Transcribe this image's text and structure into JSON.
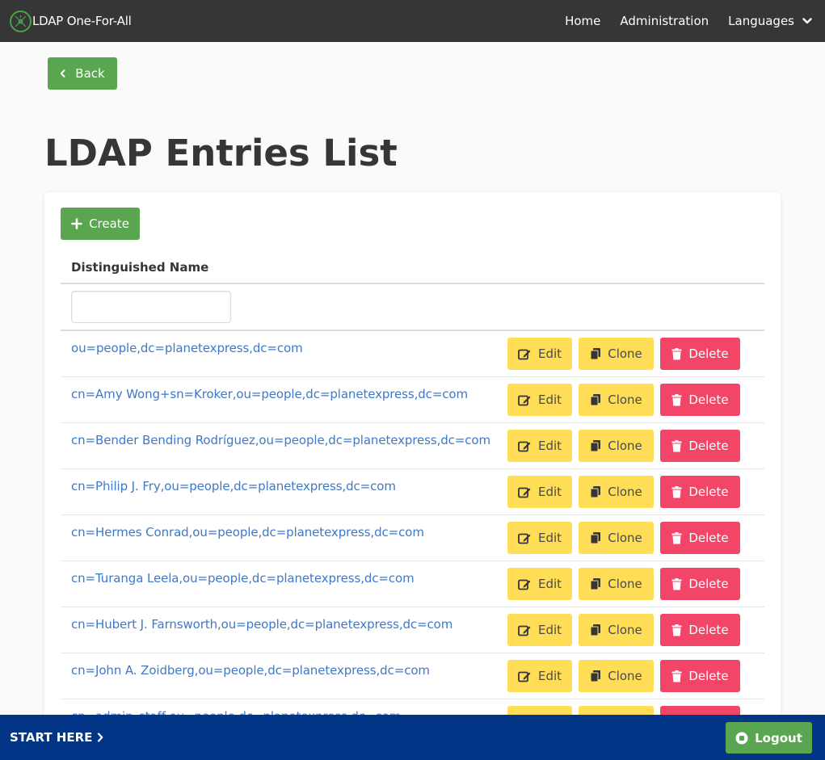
{
  "navbar": {
    "brand": "LDAP One-For-All",
    "items": [
      {
        "label": "Home"
      },
      {
        "label": "Administration"
      },
      {
        "label": "Languages",
        "icon": "chevron-down-icon"
      }
    ]
  },
  "back_button": {
    "label": "Back",
    "icon": "chevron-left-icon"
  },
  "page_title": "LDAP Entries List",
  "create_button": {
    "label": "Create",
    "icon": "plus-icon"
  },
  "table": {
    "column_header": "Distinguished Name",
    "filter_value": "",
    "rows": [
      {
        "dn": "ou=people,dc=planetexpress,dc=com"
      },
      {
        "dn": "cn=Amy Wong+sn=Kroker,ou=people,dc=planetexpress,dc=com"
      },
      {
        "dn": "cn=Bender Bending Rodríguez,ou=people,dc=planetexpress,dc=com"
      },
      {
        "dn": "cn=Philip J. Fry,ou=people,dc=planetexpress,dc=com"
      },
      {
        "dn": "cn=Hermes Conrad,ou=people,dc=planetexpress,dc=com"
      },
      {
        "dn": "cn=Turanga Leela,ou=people,dc=planetexpress,dc=com"
      },
      {
        "dn": "cn=Hubert J. Farnsworth,ou=people,dc=planetexpress,dc=com"
      },
      {
        "dn": "cn=John A. Zoidberg,ou=people,dc=planetexpress,dc=com"
      },
      {
        "dn": "cn=admin_staff,ou=people,dc=planetexpress,dc=com"
      }
    ],
    "actions": {
      "edit": "Edit",
      "clone": "Clone",
      "delete": "Delete"
    }
  },
  "bottombar": {
    "start_here": "START HERE",
    "logout": "Logout"
  },
  "colors": {
    "navbar": "#363636",
    "success": "#5aa54f",
    "warning": "#ffdd57",
    "danger": "#f14668",
    "link": "#3f78c8",
    "bottombar": "#023586"
  }
}
